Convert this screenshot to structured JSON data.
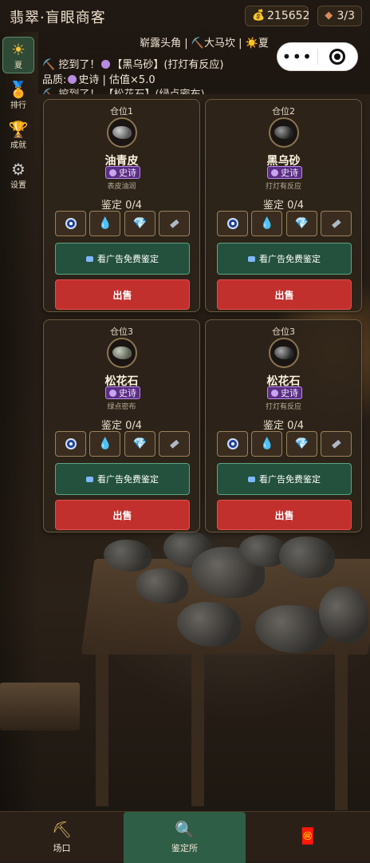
{
  "header": {
    "title": "翡翠·盲眼商客",
    "coins": "215652",
    "stones": "3/3"
  },
  "sidebar": [
    {
      "label": "夏",
      "icon": "sun-icon",
      "active": true
    },
    {
      "label": "排行",
      "icon": "medal-icon",
      "active": false
    },
    {
      "label": "成就",
      "icon": "trophy-icon",
      "active": false
    },
    {
      "label": "设置",
      "icon": "gear-icon",
      "active": false
    }
  ],
  "info": {
    "location": "崭露头角 | ⛏️大马坎 | ☀️夏",
    "log1_prefix": "⛏️ 挖到了！",
    "log1_item": "【黑乌砂】(打灯有反应)",
    "log2_prefix": "品质:",
    "log2_rest": "史诗 | 估值×5.0",
    "log3": "⛏️ 挖到了！ 【松花石】(绿点密布)"
  },
  "cards": [
    {
      "slot": "仓位1",
      "name": "油青皮",
      "tier": "史诗",
      "hint": "表皮油润",
      "appraise": "鉴定 0/4",
      "ad_label": "看广告免费鉴定",
      "sell_label": "出售"
    },
    {
      "slot": "仓位2",
      "name": "黑乌砂",
      "tier": "史诗",
      "hint": "打灯有反应",
      "appraise": "鉴定 0/4",
      "ad_label": "看广告免费鉴定",
      "sell_label": "出售"
    },
    {
      "slot": "仓位3",
      "name": "松花石",
      "tier": "史诗",
      "hint": "绿点密布",
      "appraise": "鉴定 0/4",
      "ad_label": "看广告免费鉴定",
      "sell_label": "出售"
    },
    {
      "slot": "仓位3",
      "name": "松花石",
      "tier": "史诗",
      "hint": "打灯有反应",
      "appraise": "鉴定 0/4",
      "ad_label": "看广告免费鉴定",
      "sell_label": "出售"
    }
  ],
  "tools": [
    "eye-icon",
    "water-drop-icon",
    "diamond-icon",
    "flashlight-icon"
  ],
  "bottom_nav": [
    {
      "label": "场口",
      "icon": "pickaxe-icon"
    },
    {
      "label": "鉴定所",
      "icon": "magnifier-icon",
      "active": true
    },
    {
      "label": "",
      "icon": "red-envelope-icon"
    }
  ],
  "colors": {
    "sell": "#c2302d",
    "ad": "#23513d",
    "epic": "#5a2e82",
    "active_tab": "#2f5e46"
  }
}
